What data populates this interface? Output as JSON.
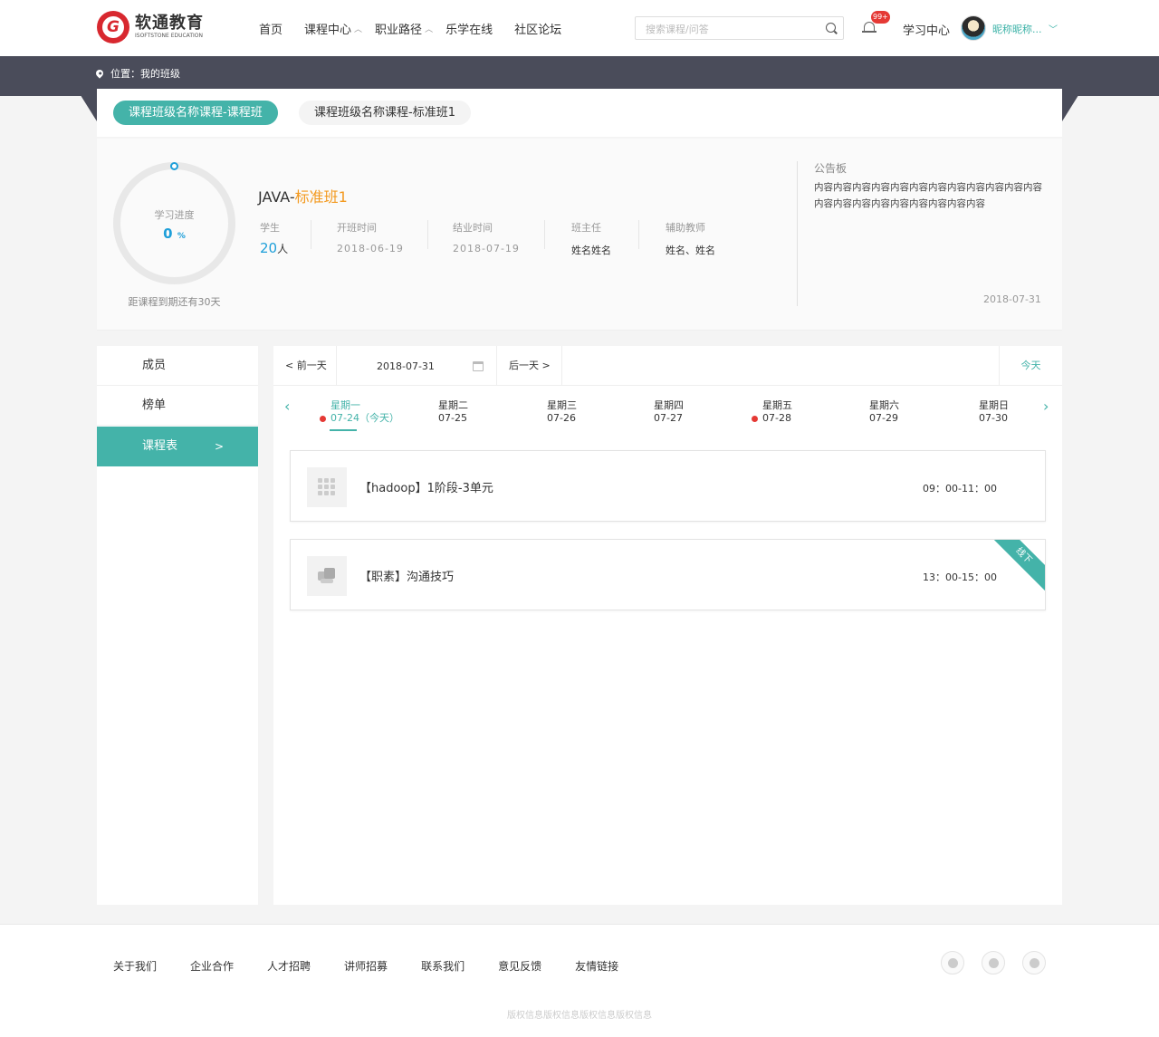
{
  "header": {
    "logo_cn": "软通教育",
    "logo_en": "ISOFTSTONE EDUCATION",
    "logo_letter": "G",
    "nav": [
      {
        "label": "首页"
      },
      {
        "label": "课程中心"
      },
      {
        "label": "职业路径"
      },
      {
        "label": "乐学在线"
      },
      {
        "label": "社区论坛"
      }
    ],
    "search_placeholder": "搜索课程/问答",
    "badge": "99+",
    "study_center": "学习中心",
    "nickname": "昵称昵称..."
  },
  "breadcrumb": "位置：我的班级",
  "class_tabs": [
    {
      "label": "课程班级名称课程-课程班"
    },
    {
      "label": "课程班级名称课程-标准班1"
    }
  ],
  "class_info": {
    "progress_label": "学习进度",
    "progress_value": "0",
    "progress_unit": "%",
    "countdown": "距课程到期还有30天",
    "title_prefix": "JAVA-",
    "title_highlight": "标准班1",
    "stats": {
      "students_label": "学生",
      "students_value": "20",
      "students_unit": "人",
      "start_label": "开班时间",
      "start_value": "2018-06-19",
      "end_label": "结业时间",
      "end_value": "2018-07-19",
      "teacher_label": "班主任",
      "teacher_value": "姓名姓名",
      "assistant_label": "辅助教师",
      "assistant_value": "姓名、姓名"
    },
    "notice_title": "公告板",
    "notice_body": "内容内容内容内容内容内容内容内容内容内容内容内容内容内容内容内容内容内容内容内容内容",
    "notice_date": "2018-07-31"
  },
  "sidebar": [
    {
      "label": "成员"
    },
    {
      "label": "榜单"
    },
    {
      "label": "课程表",
      "arrow": ">"
    }
  ],
  "daybar": {
    "prev": "< 前一天",
    "date": "2018-07-31",
    "next": "后一天 >",
    "today": "今天"
  },
  "week": [
    {
      "day": "星期一",
      "date": "07-24（今天）",
      "dot": true,
      "active": true
    },
    {
      "day": "星期二",
      "date": "07-25",
      "dot": false
    },
    {
      "day": "星期三",
      "date": "07-26",
      "dot": false
    },
    {
      "day": "星期四",
      "date": "07-27",
      "dot": false
    },
    {
      "day": "星期五",
      "date": "07-28",
      "dot": true
    },
    {
      "day": "星期六",
      "date": "07-29",
      "dot": false
    },
    {
      "day": "星期日",
      "date": "07-30",
      "dot": false
    }
  ],
  "lessons": [
    {
      "name": "【hadoop】1阶段-3单元",
      "time": "09：00-11：00",
      "ribbon": ""
    },
    {
      "name": "【职素】沟通技巧",
      "time": "13：00-15：00",
      "ribbon": "线下"
    }
  ],
  "footer": {
    "links": [
      "关于我们",
      "企业合作",
      "人才招聘",
      "讲师招募",
      "联系我们",
      "意见反馈",
      "友情链接"
    ],
    "copyright": "版权信息版权信息版权信息版权信息"
  },
  "colors": {
    "accent": "#44b3a9",
    "progress": "#1e9fd9",
    "highlight": "#f39a20",
    "dark_band": "#4a4c5a",
    "badge": "#e53935"
  }
}
